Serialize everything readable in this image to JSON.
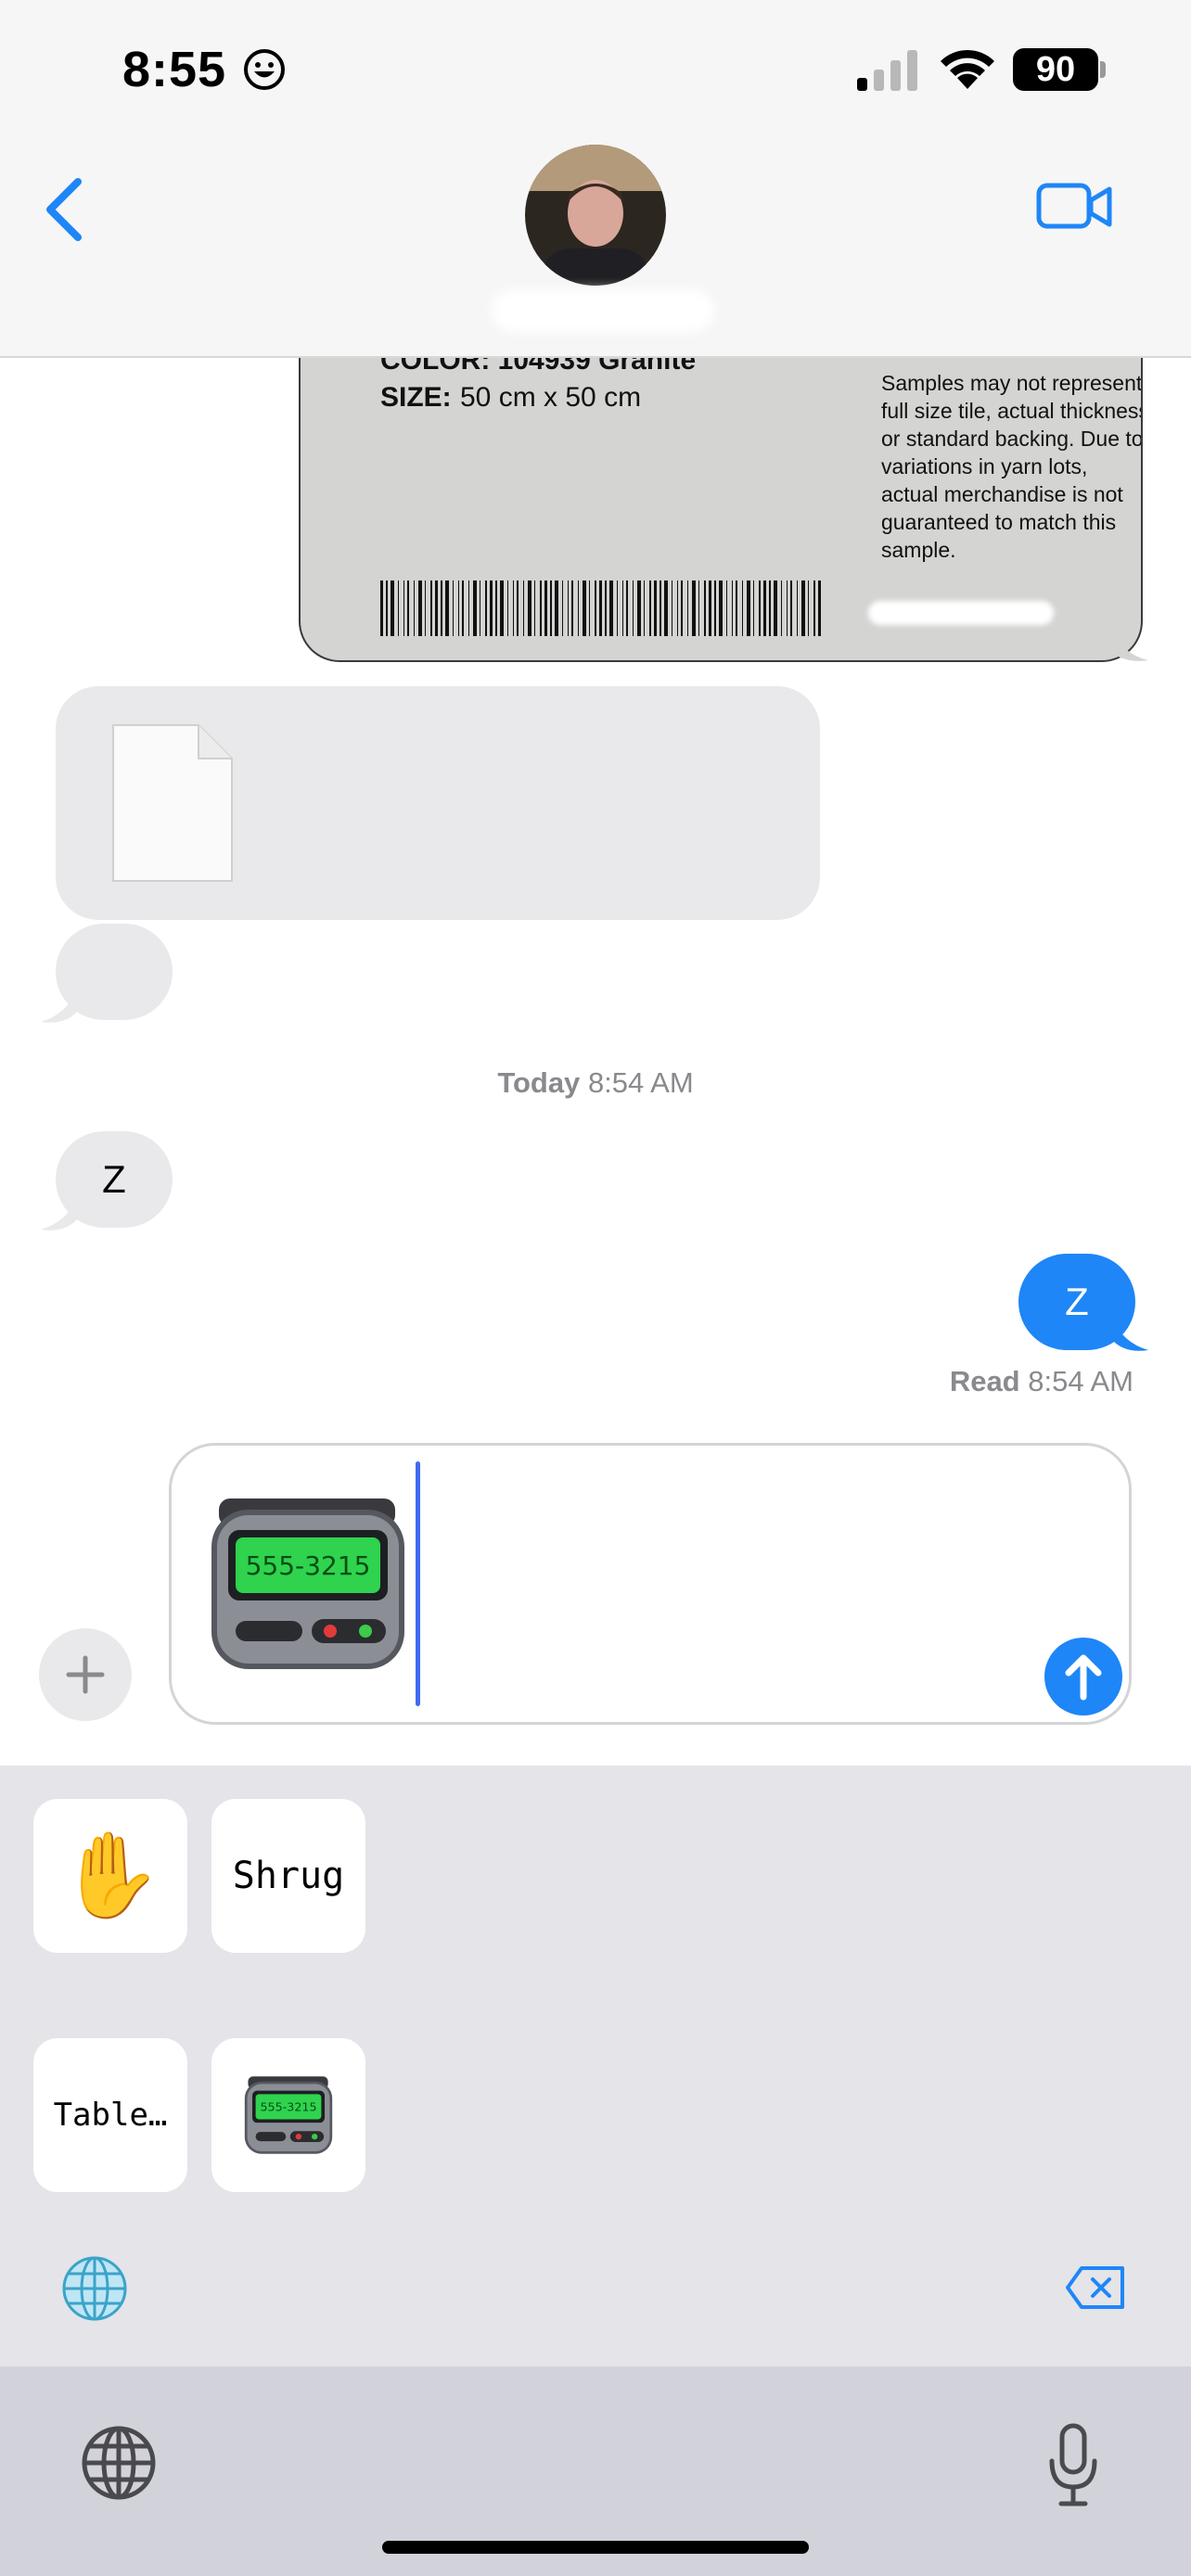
{
  "status_bar": {
    "time": "8:55",
    "battery_level": "90",
    "signal_bars_active": 1,
    "signal_bars_total": 4
  },
  "header": {
    "back_icon": "chevron-left-icon",
    "video_icon": "video-camera-icon",
    "accent_color": "#1e86f7"
  },
  "sticker_label": {
    "color_line": "COLOR: 104939 Granite",
    "size_label": "SIZE:",
    "size_value": "50 cm x 50 cm",
    "note": "Samples may not represent full size tile, actual thickness or standard backing. Due to variations in yarn lots, actual merchandise is not guaranteed to match this sample."
  },
  "messages": {
    "timestamp_day": "Today",
    "timestamp_time": "8:54 AM",
    "incoming_text": "Z",
    "outgoing_text": "Z",
    "read_label": "Read",
    "read_time": "8:54 AM"
  },
  "compose": {
    "pager_display": "555-3215"
  },
  "panel": {
    "tile_emoji": "✋",
    "tile_shrug": "Shrug",
    "tile_table": "Table…",
    "pager_display_small": "555-3215"
  }
}
